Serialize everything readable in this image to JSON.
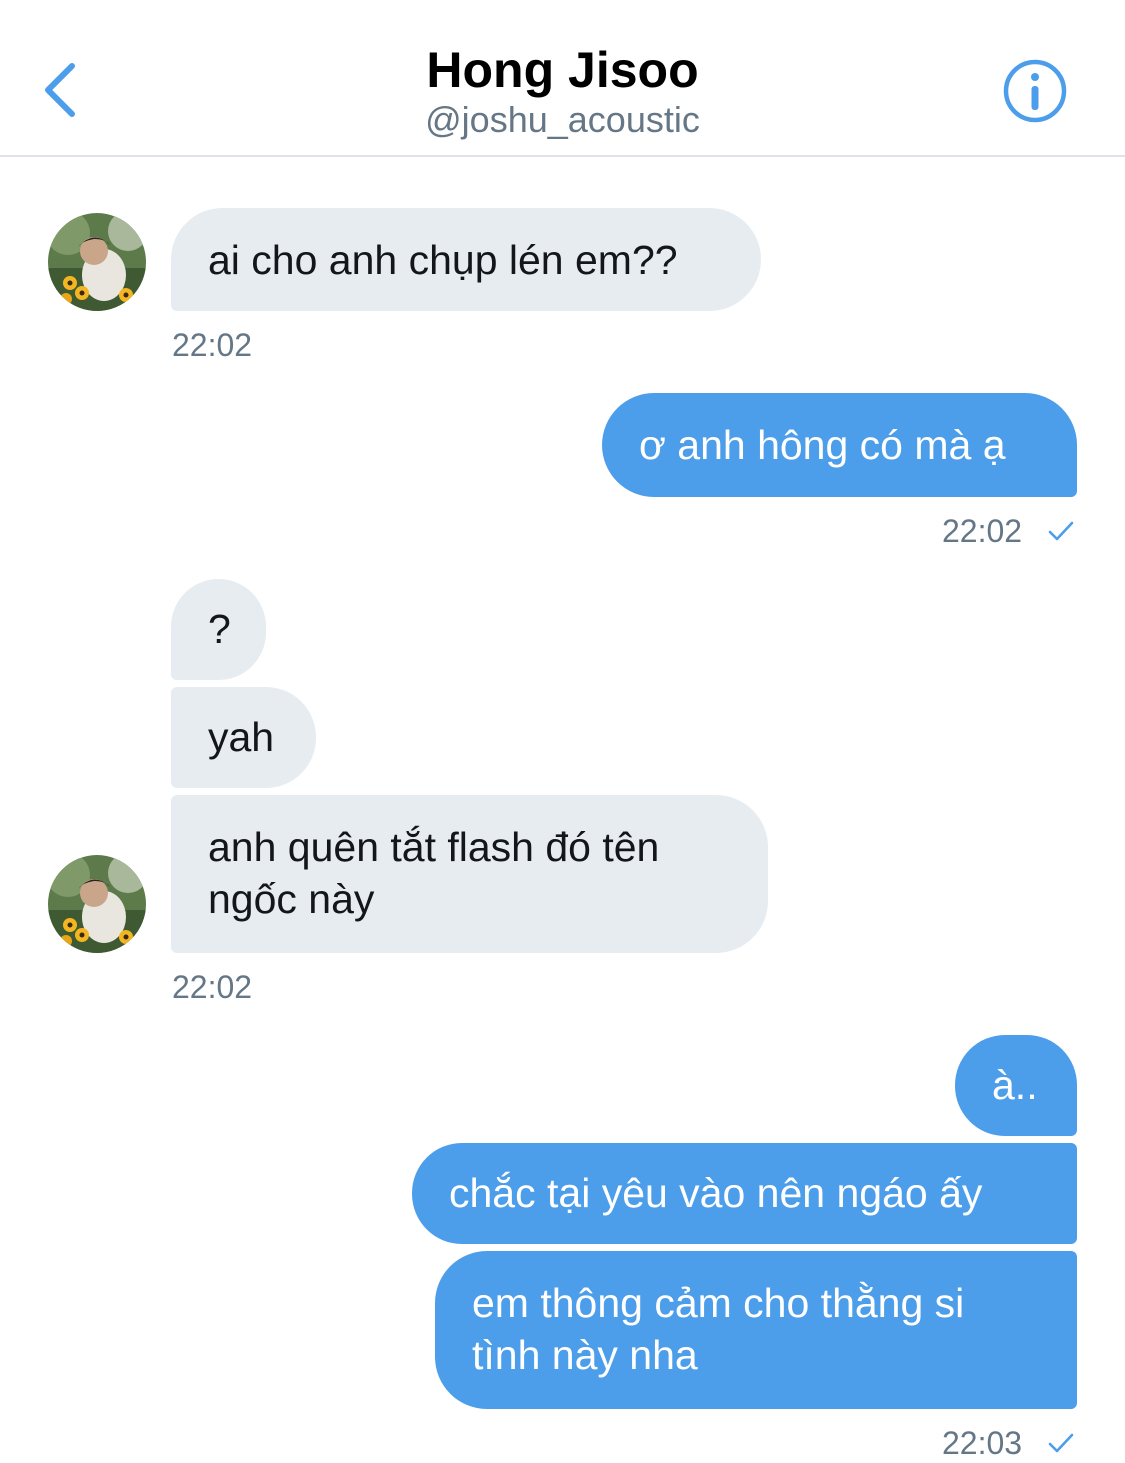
{
  "header": {
    "title": "Hong Jisoo",
    "handle": "@joshu_acoustic",
    "back_icon": "chevron-left-icon",
    "info_icon": "info-icon",
    "accent_color": "#4c9eea"
  },
  "messages": [
    {
      "from": "them",
      "text": "ai cho anh chụp lén em??"
    },
    {
      "from": "them",
      "time": "22:02"
    },
    {
      "from": "me",
      "text": "ơ anh hông có mà ạ"
    },
    {
      "from": "me",
      "time": "22:02",
      "status": "sent-check-icon"
    },
    {
      "from": "them",
      "text": "?"
    },
    {
      "from": "them",
      "text": "yah"
    },
    {
      "from": "them",
      "text": "anh quên tắt flash đó tên ngốc này"
    },
    {
      "from": "them",
      "time": "22:02"
    },
    {
      "from": "me",
      "text": "à.."
    },
    {
      "from": "me",
      "text": "chắc tại yêu vào nên ngáo ấy"
    },
    {
      "from": "me",
      "text": "em thông cảm cho thằng si tình này nha"
    },
    {
      "from": "me",
      "time": "22:03",
      "status": "sent-check-icon"
    }
  ],
  "colors": {
    "incoming_bubble": "#e6ecf0",
    "outgoing_bubble": "#4c9eea",
    "timestamp": "#657786"
  }
}
